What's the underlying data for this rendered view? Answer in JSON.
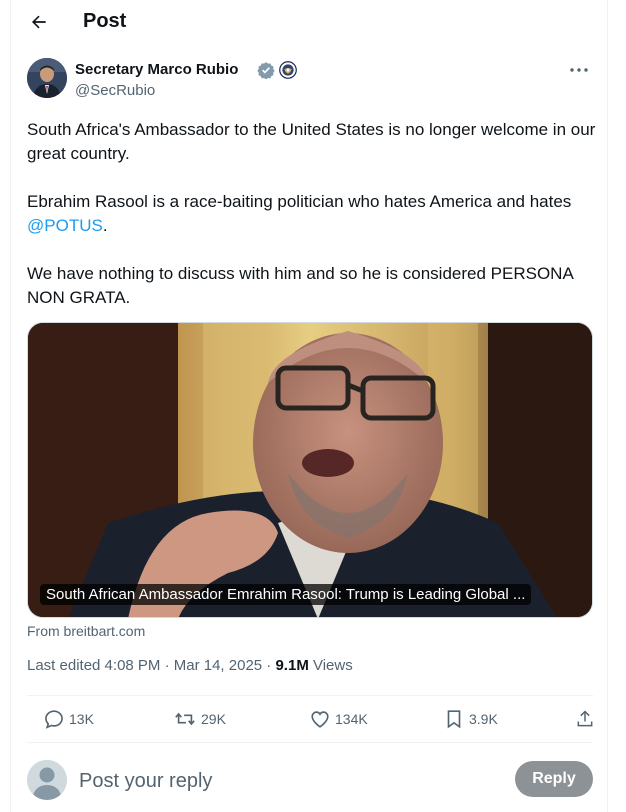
{
  "header": {
    "title": "Post"
  },
  "author": {
    "name": "Secretary Marco Rubio",
    "handle": "@SecRubio"
  },
  "post": {
    "para1": "South Africa's Ambassador to the United States is no longer welcome in our great country.",
    "para2_text": "Ebrahim Rasool is a race-baiting politician who hates America and hates ",
    "para2_mention": "@POTUS",
    "para2_end": ".",
    "para3": "We have nothing to discuss with him and so he is considered PERSONA NON GRATA."
  },
  "card": {
    "caption": "South African Ambassador Emrahim Rasool: Trump is Leading Global ...",
    "source": "From breitbart.com"
  },
  "meta": {
    "edited": "Last edited 4:08 PM · Mar 14, 2025 · ",
    "views_count": "9.1M",
    "views_label": " Views"
  },
  "actions": {
    "replies": "13K",
    "reposts": "29K",
    "likes": "134K",
    "bookmarks": "3.9K"
  },
  "reply": {
    "placeholder": "Post your reply",
    "button": "Reply"
  },
  "colors": {
    "accent": "#1d9bf0",
    "muted": "#536471",
    "verified": "#829aab"
  }
}
